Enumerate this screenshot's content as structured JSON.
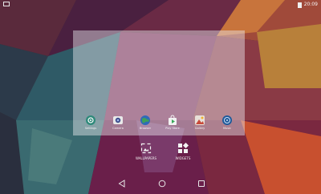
{
  "statusbar": {
    "time": "20:09"
  },
  "dock": {
    "apps": [
      {
        "label": "Settings",
        "icon": "settings-icon"
      },
      {
        "label": "Camera",
        "icon": "camera-icon"
      },
      {
        "label": "Browser",
        "icon": "browser-globe-icon"
      },
      {
        "label": "Play Store",
        "icon": "store-bag-icon"
      },
      {
        "label": "Gallery",
        "icon": "gallery-icon"
      },
      {
        "label": "Music",
        "icon": "music-icon"
      }
    ]
  },
  "actions": {
    "wallpapers": "WALLPAPERS",
    "widgets": "WIDGETS"
  },
  "navbar": {
    "back_icon": "back-triangle-icon",
    "home_icon": "home-circle-icon",
    "recents_icon": "recents-square-icon"
  },
  "colors": {
    "preview_overlay": "#ebebf0",
    "wallpaper_dark": "#3a2a2e",
    "wallpaper_magenta": "#8a2050",
    "wallpaper_orange": "#c87a3a",
    "wallpaper_teal": "#2f6a6e"
  }
}
